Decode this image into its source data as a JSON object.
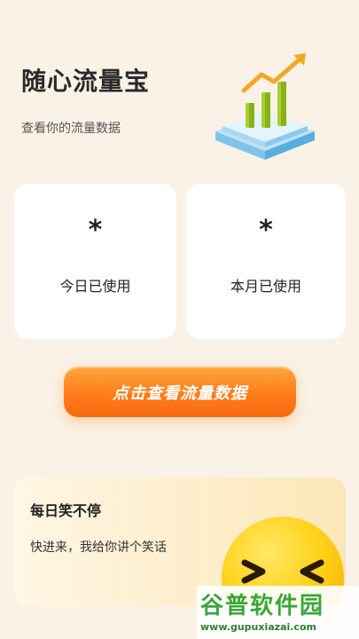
{
  "header": {
    "title": "随心流量宝",
    "subtitle": "查看你的流量数据"
  },
  "hero": {
    "icon": "growth-chart-illustration"
  },
  "usage_cards": [
    {
      "value": "*",
      "label": "今日已使用"
    },
    {
      "value": "*",
      "label": "本月已使用"
    }
  ],
  "cta": {
    "label": "点击查看流量数据"
  },
  "joke_card": {
    "title": "每日笑不停",
    "description": "快进来，我给你讲个笑话",
    "icon": "laughing-emoji-icon"
  },
  "watermark": {
    "title": "谷普软件园",
    "url": "www.gupuxiazai.com"
  },
  "colors": {
    "background": "#faf2e6",
    "accent": "#ff7a18",
    "card": "#ffffff"
  }
}
